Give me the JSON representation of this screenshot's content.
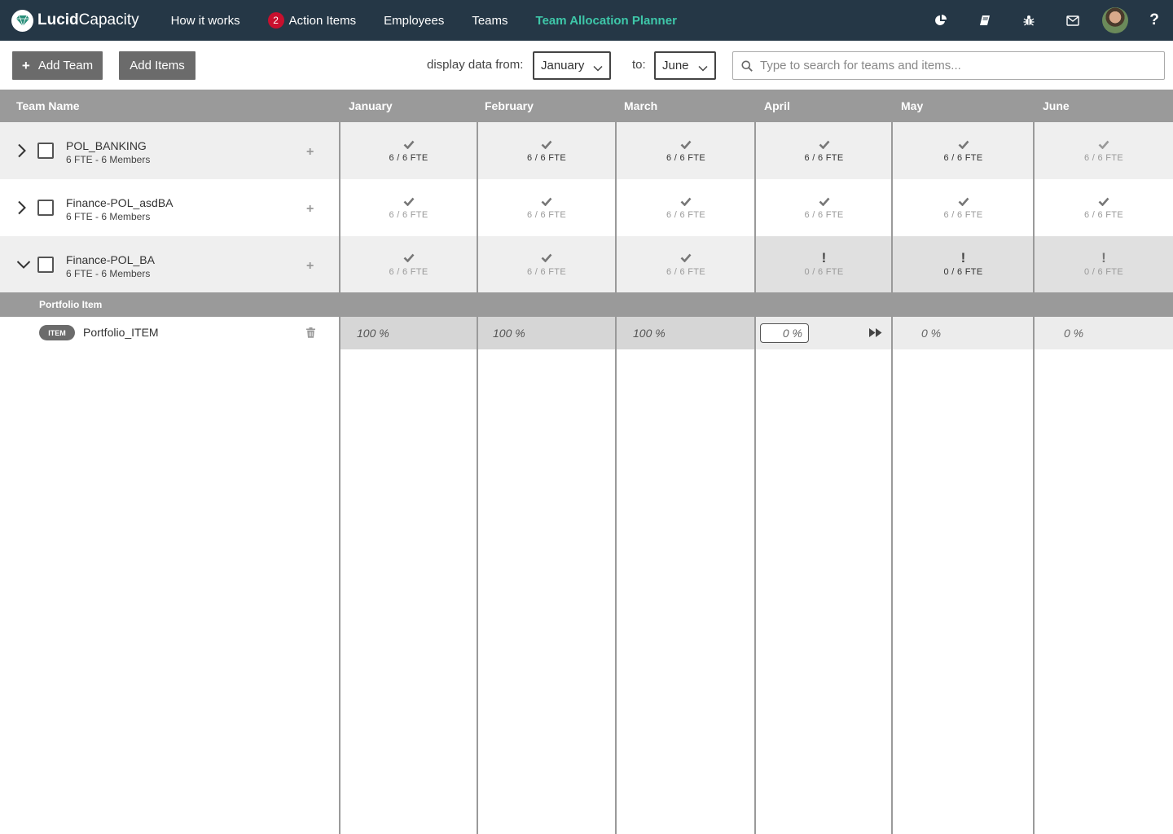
{
  "nav": {
    "logo_bold": "Lucid",
    "logo_light": "Capacity",
    "links": {
      "how_it_works": "How it works",
      "action_items": "Action Items",
      "action_items_badge": "2",
      "employees": "Employees",
      "teams": "Teams",
      "team_allocation_planner": "Team Allocation Planner"
    },
    "right_icons": [
      "pie-chart-icon",
      "book-icon",
      "bug-icon",
      "envelope-icon",
      "avatar",
      "help-icon"
    ],
    "help_label": "?"
  },
  "toolbar": {
    "add_team_label": "Add Team",
    "add_items_label": "Add Items",
    "display_from_label": "display data from:",
    "from_value": "January",
    "to_label": "to:",
    "to_value": "June",
    "search_placeholder": "Type to search for teams and items..."
  },
  "grid": {
    "team_name_header": "Team Name",
    "months": [
      "January",
      "February",
      "March",
      "April",
      "May",
      "June"
    ],
    "teams": [
      {
        "name": "POL_BANKING",
        "sub": "6 FTE - 6 Members",
        "expanded": false,
        "cells": [
          {
            "status": "ok",
            "fte": "6 / 6 FTE"
          },
          {
            "status": "ok",
            "fte": "6 / 6 FTE"
          },
          {
            "status": "ok",
            "fte": "6 / 6 FTE"
          },
          {
            "status": "ok",
            "fte": "6 / 6 FTE"
          },
          {
            "status": "ok",
            "fte": "6 / 6 FTE"
          },
          {
            "status": "ok",
            "fte": "6 / 6 FTE"
          }
        ]
      },
      {
        "name": "Finance-POL_asdBA",
        "sub": "6 FTE - 6 Members",
        "expanded": false,
        "cells": [
          {
            "status": "ok",
            "fte": "6 / 6 FTE"
          },
          {
            "status": "ok",
            "fte": "6 / 6 FTE"
          },
          {
            "status": "ok",
            "fte": "6 / 6 FTE"
          },
          {
            "status": "ok",
            "fte": "6 / 6 FTE"
          },
          {
            "status": "ok",
            "fte": "6 / 6 FTE"
          },
          {
            "status": "ok",
            "fte": "6 / 6 FTE"
          }
        ]
      },
      {
        "name": "Finance-POL_BA",
        "sub": "6 FTE - 6 Members",
        "expanded": true,
        "cells": [
          {
            "status": "ok",
            "fte": "6 / 6 FTE"
          },
          {
            "status": "ok",
            "fte": "6 / 6 FTE"
          },
          {
            "status": "ok",
            "fte": "6 / 6 FTE"
          },
          {
            "status": "warn",
            "fte": "0 / 6 FTE"
          },
          {
            "status": "warn",
            "fte": "0 / 6 FTE"
          },
          {
            "status": "warn",
            "fte": "0 / 6 FTE"
          }
        ]
      }
    ],
    "subheader": "Portfolio Item",
    "item": {
      "tag": "ITEM",
      "name": "Portfolio_ITEM",
      "values": [
        "100 %",
        "100 %",
        "100 %",
        "0 %",
        "0 %",
        "0 %"
      ]
    }
  },
  "colors": {
    "navbar": "#253746",
    "accent": "#3ec7a9",
    "badge": "#c8102e",
    "header_gray": "#9a9a9a",
    "button_gray": "#6b6b6b"
  }
}
